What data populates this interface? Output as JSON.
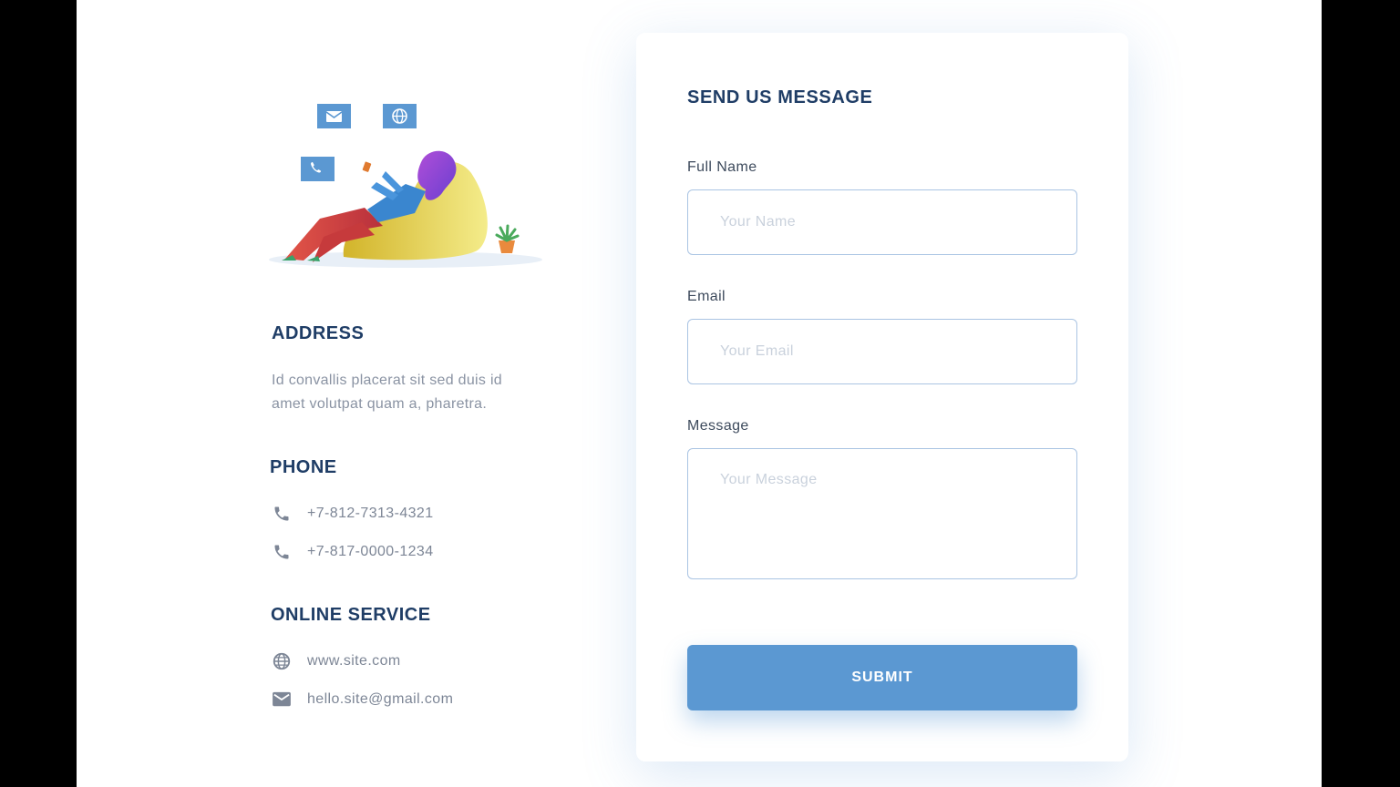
{
  "colors": {
    "accent": "#5b98d2",
    "heading": "#1f3d66",
    "body_text": "#7d8696",
    "field_border": "#aac4e3"
  },
  "illustration": {
    "icons": [
      "mail-icon",
      "globe-icon",
      "phone-icon"
    ]
  },
  "address": {
    "title": "ADDRESS",
    "text": "Id convallis placerat sit sed duis id amet volutpat quam a, pharetra."
  },
  "phone": {
    "title": "PHONE",
    "numbers": [
      "+7-812-7313-4321",
      "+7-817-0000-1234"
    ]
  },
  "online": {
    "title": "ONLINE SERVICE",
    "website": "www.site.com",
    "email": "hello.site@gmail.com"
  },
  "form": {
    "title": "SEND US MESSAGE",
    "name_label": "Full Name",
    "name_placeholder": "Your Name",
    "name_value": "",
    "email_label": "Email",
    "email_placeholder": "Your Email",
    "email_value": "",
    "message_label": "Message",
    "message_placeholder": "Your Message",
    "message_value": "",
    "submit_label": "SUBMIT"
  }
}
